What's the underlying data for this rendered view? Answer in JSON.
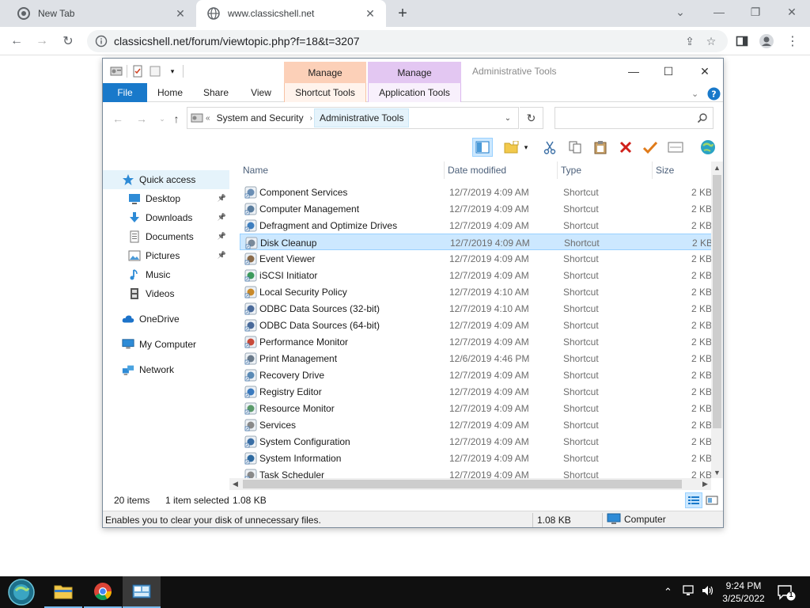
{
  "browser": {
    "tabs": [
      {
        "title": "New Tab"
      },
      {
        "title": "www.classicshell.net"
      }
    ],
    "url": "classicshell.net/forum/viewtopic.php?f=18&t=3207"
  },
  "explorer": {
    "window_title": "Administrative Tools",
    "context_headers": [
      "Manage",
      "Manage"
    ],
    "ribbon_tabs": [
      "File",
      "Home",
      "Share",
      "View",
      "Shortcut Tools",
      "Application Tools"
    ],
    "breadcrumb": {
      "overflow": "«",
      "items": [
        "System and Security",
        "Administrative Tools"
      ]
    },
    "search_placeholder": "",
    "nav": [
      {
        "label": "Quick access",
        "icon": "star-icon",
        "selected": true
      },
      {
        "label": "Desktop",
        "icon": "desktop-icon",
        "pinned": true
      },
      {
        "label": "Downloads",
        "icon": "download-icon",
        "pinned": true
      },
      {
        "label": "Documents",
        "icon": "documents-icon",
        "pinned": true
      },
      {
        "label": "Pictures",
        "icon": "pictures-icon",
        "pinned": true
      },
      {
        "label": "Music",
        "icon": "music-icon"
      },
      {
        "label": "Videos",
        "icon": "videos-icon"
      },
      {
        "label": "OneDrive",
        "icon": "cloud-icon"
      },
      {
        "label": "My Computer",
        "icon": "computer-icon"
      },
      {
        "label": "Network",
        "icon": "network-icon"
      }
    ],
    "columns": [
      "Name",
      "Date modified",
      "Type",
      "Size"
    ],
    "files": [
      {
        "name": "Component Services",
        "date": "12/7/2019 4:09 AM",
        "type": "Shortcut",
        "size": "2 KB"
      },
      {
        "name": "Computer Management",
        "date": "12/7/2019 4:09 AM",
        "type": "Shortcut",
        "size": "2 KB"
      },
      {
        "name": "Defragment and Optimize Drives",
        "date": "12/7/2019 4:09 AM",
        "type": "Shortcut",
        "size": "2 KB"
      },
      {
        "name": "Disk Cleanup",
        "date": "12/7/2019 4:09 AM",
        "type": "Shortcut",
        "size": "2 KB",
        "selected": true
      },
      {
        "name": "Event Viewer",
        "date": "12/7/2019 4:09 AM",
        "type": "Shortcut",
        "size": "2 KB"
      },
      {
        "name": "iSCSI Initiator",
        "date": "12/7/2019 4:09 AM",
        "type": "Shortcut",
        "size": "2 KB"
      },
      {
        "name": "Local Security Policy",
        "date": "12/7/2019 4:10 AM",
        "type": "Shortcut",
        "size": "2 KB"
      },
      {
        "name": "ODBC Data Sources (32-bit)",
        "date": "12/7/2019 4:10 AM",
        "type": "Shortcut",
        "size": "2 KB"
      },
      {
        "name": "ODBC Data Sources (64-bit)",
        "date": "12/7/2019 4:09 AM",
        "type": "Shortcut",
        "size": "2 KB"
      },
      {
        "name": "Performance Monitor",
        "date": "12/7/2019 4:09 AM",
        "type": "Shortcut",
        "size": "2 KB"
      },
      {
        "name": "Print Management",
        "date": "12/6/2019 4:46 PM",
        "type": "Shortcut",
        "size": "2 KB"
      },
      {
        "name": "Recovery Drive",
        "date": "12/7/2019 4:09 AM",
        "type": "Shortcut",
        "size": "2 KB"
      },
      {
        "name": "Registry Editor",
        "date": "12/7/2019 4:09 AM",
        "type": "Shortcut",
        "size": "2 KB"
      },
      {
        "name": "Resource Monitor",
        "date": "12/7/2019 4:09 AM",
        "type": "Shortcut",
        "size": "2 KB"
      },
      {
        "name": "Services",
        "date": "12/7/2019 4:09 AM",
        "type": "Shortcut",
        "size": "2 KB"
      },
      {
        "name": "System Configuration",
        "date": "12/7/2019 4:09 AM",
        "type": "Shortcut",
        "size": "2 KB"
      },
      {
        "name": "System Information",
        "date": "12/7/2019 4:09 AM",
        "type": "Shortcut",
        "size": "2 KB"
      },
      {
        "name": "Task Scheduler",
        "date": "12/7/2019 4:09 AM",
        "type": "Shortcut",
        "size": "2 KB"
      }
    ],
    "status": {
      "item_count": "20 items",
      "selection": "1 item selected",
      "selection_size": "1.08 KB",
      "description": "Enables you to clear your disk of unnecessary files.",
      "size": "1.08 KB",
      "location": "Computer"
    }
  },
  "taskbar": {
    "time": "9:24 PM",
    "date": "3/25/2022",
    "notifications": "1"
  },
  "colors": {
    "file_tab": "#1979ca",
    "shortcut_tools": "#fcd0b8",
    "application_tools": "#e3c7f2",
    "selection": "#cce8ff",
    "taskbar": "#101010"
  }
}
